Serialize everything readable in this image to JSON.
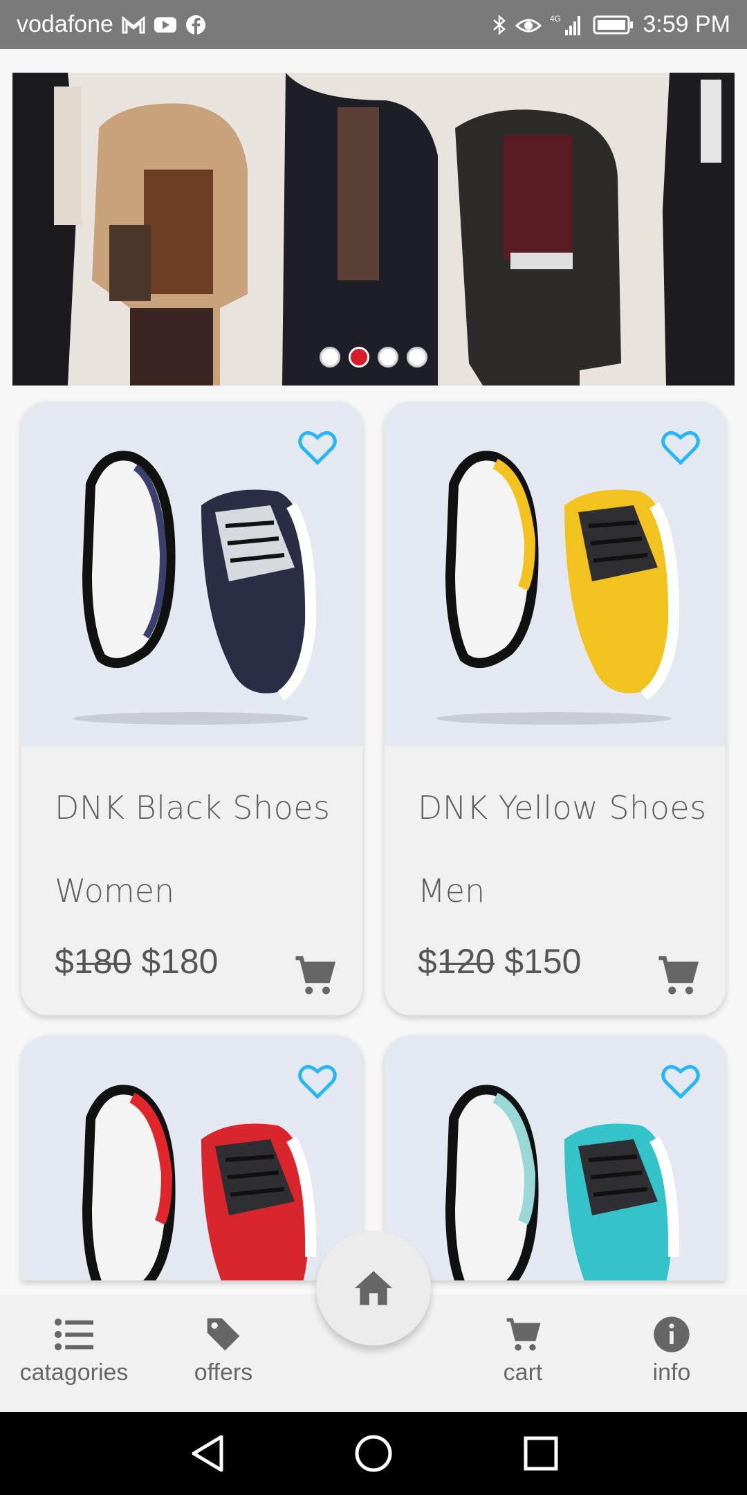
{
  "status_bar": {
    "carrier": "vodafone",
    "network": "4G",
    "time": "3:59 PM",
    "icons": [
      "gmail-icon",
      "youtube-icon",
      "facebook-icon",
      "bluetooth-icon",
      "eye-icon",
      "signal-icon",
      "battery-icon"
    ]
  },
  "banner": {
    "slides": 4,
    "active_slide": 2
  },
  "products": [
    {
      "name": "DNK Black Shoes",
      "gender": "Women",
      "old_price": "$180",
      "price": "$180",
      "accent": "#3a3f6b"
    },
    {
      "name": "DNK Yellow Shoes",
      "gender": "Men",
      "old_price": "$120",
      "price": "$150",
      "accent": "#f4c21f"
    },
    {
      "name": "",
      "gender": "",
      "old_price": "",
      "price": "",
      "accent": "#e0262b"
    },
    {
      "name": "",
      "gender": "",
      "old_price": "",
      "price": "",
      "accent": "#33c3c9"
    }
  ],
  "bottom_nav": {
    "categories_label": "catagories",
    "offers_label": "offers",
    "cart_label": "cart",
    "info_label": "info"
  },
  "colors": {
    "favorite": "#29b6f6",
    "active_dot": "#d81b2a"
  }
}
